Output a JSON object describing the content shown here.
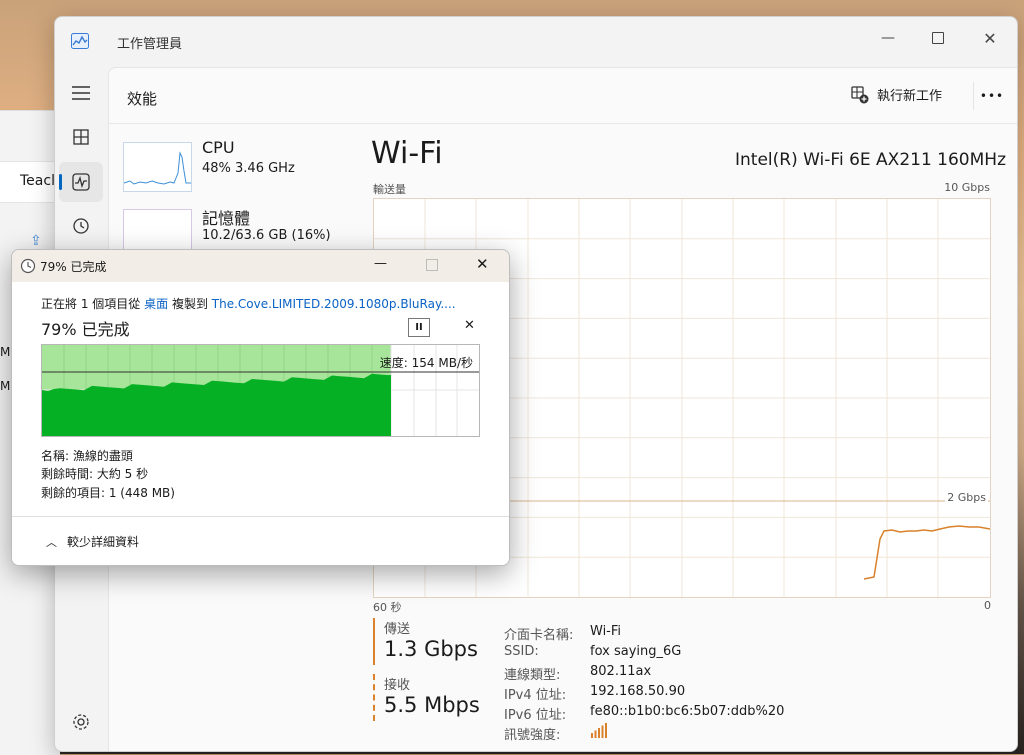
{
  "background": {
    "partial_tab": "Teacl",
    "partial_items": [
      "MI",
      "MI"
    ]
  },
  "task_manager": {
    "title": "工作管理員",
    "page_title": "效能",
    "run_new_task": "執行新工作",
    "more": "•••",
    "sidebar_items": [
      "hamburger-menu-icon",
      "processes-icon",
      "performance-icon",
      "app-history-icon",
      "settings-icon"
    ],
    "resources": [
      {
        "name": "CPU",
        "detail": "48%  3.46 GHz"
      },
      {
        "name": "記憶體",
        "detail": "10.2/63.6 GB (16%)"
      }
    ],
    "main": {
      "title": "Wi-Fi",
      "adapter": "Intel(R) Wi-Fi 6E AX211 160MHz",
      "graph_label": "輸送量",
      "graph_max": "10 Gbps",
      "graph_mid": "2 Gbps",
      "time_left": "60 秒",
      "time_right": "0",
      "send_label": "傳送",
      "send_value": "1.3 Gbps",
      "recv_label": "接收",
      "recv_value": "5.5 Mbps",
      "info": [
        {
          "label": "介面卡名稱:",
          "value": "Wi-Fi"
        },
        {
          "label": "SSID:",
          "value": "fox saying_6G"
        },
        {
          "label": "連線類型:",
          "value": "802.11ax"
        },
        {
          "label": "IPv4 位址:",
          "value": "192.168.50.90"
        },
        {
          "label": "IPv6 位址:",
          "value": "fe80::b1b0:bc6:5b07:ddb%20"
        },
        {
          "label": "訊號強度:",
          "value": ""
        }
      ]
    }
  },
  "copy_dialog": {
    "title": "79% 已完成",
    "line_prefix": "正在將 1 個項目從",
    "from": "桌面",
    "copy_to": "複製到",
    "to": "The.Cove.LIMITED.2009.1080p.BluRay....",
    "percent_text": "79% 已完成",
    "progress": 0.79,
    "speed": "速度: 154 MB/秒",
    "name": "名稱: 漁線的盡頭",
    "time_left": "剩餘時間: 大約 5 秒",
    "items_left": "剩餘的項目: 1 (448 MB)",
    "less_details": "較少詳細資料",
    "pause_symbol": "II",
    "cancel_symbol": "✕"
  },
  "colors": {
    "accent": "#0067c0",
    "progress_fill": "#06b025",
    "progress_track": "#a6e59a",
    "wifi_line": "#d9822b"
  }
}
